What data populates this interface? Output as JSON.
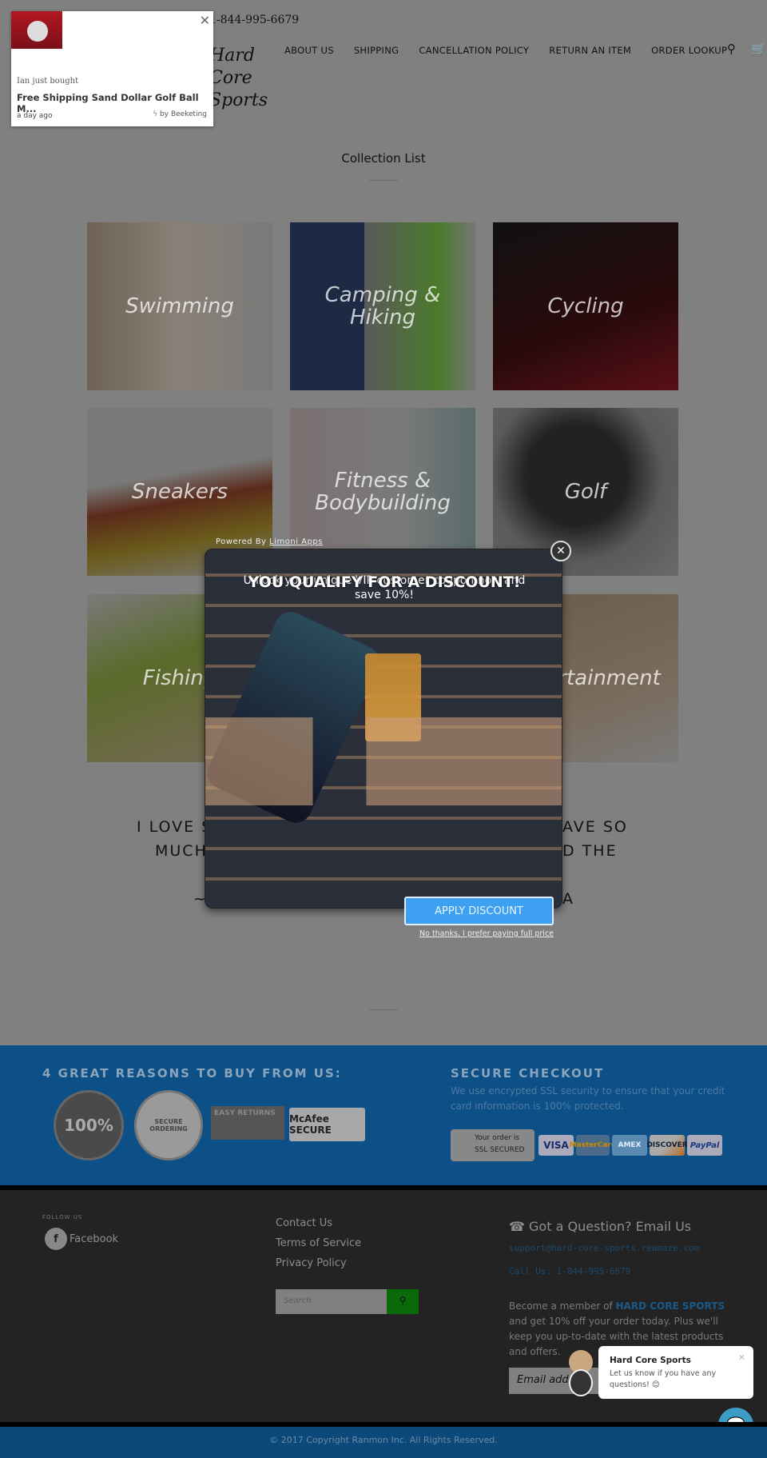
{
  "header": {
    "phone": "1-844-995-6679",
    "logo": "Hard Core Sports",
    "nav": [
      "ABOUT US",
      "SHIPPING",
      "CANCELLATION POLICY",
      "RETURN AN ITEM",
      "ORDER LOOKUP"
    ],
    "search_icon": "search-icon",
    "cart_icon": "cart-icon"
  },
  "collection": {
    "title": "Collection List",
    "items": [
      "Swimming",
      "Camping & Hiking",
      "Cycling",
      "Sneakers",
      "Fitness & Bodybuilding",
      "Golf",
      "Fishing",
      "Entertainment"
    ]
  },
  "testimonial": {
    "l1a": "I LOVE S",
    "l1b": "AVE SO",
    "l2a": "MUCH",
    "l2b": "D THE",
    "l3a": "~",
    "l3b": "A"
  },
  "notification": {
    "who": "Ian just bought",
    "product": "Free Shipping Sand Dollar Golf Ball M...",
    "time": "a day ago",
    "by": "by Beeketing"
  },
  "popup": {
    "powered": "Powered By",
    "powered_link": "Limoni Apps",
    "headline": "YOU QUALIFY FOR A DISCOUNT!",
    "subtext": "Unlock your unique VIP customer coupon now and save 10%!",
    "apply": "APPLY DISCOUNT",
    "decline": "No thanks, I prefer paying full price"
  },
  "trust": {
    "title": "4 GREAT REASONS TO BUY FROM US:",
    "badges": [
      "100%",
      "SECURE ORDERING",
      "EASY RETURNS",
      "McAfee SECURE"
    ],
    "secure_title": "SECURE CHECKOUT",
    "secure_text": "We use encrypted SSL security to ensure that your credit card information is 100% protected.",
    "ssl": "Your order is SSL SECURED",
    "cards": [
      "VISA",
      "MasterCard",
      "AMEX",
      "DISCOVER",
      "PayPal"
    ]
  },
  "footer": {
    "follow": "FOLLOW US",
    "facebook": "Facebook",
    "links": [
      "Contact Us",
      "Terms of Service",
      "Privacy Policy"
    ],
    "search_placeholder": "Search",
    "question": "Got a Question? Email Us",
    "email": "support@hard-core-sports.reamaze.com",
    "call": "Call Us: 1-844-995-6679",
    "member_pre": "Become a member of",
    "member_brand": "HARD CORE SPORTS",
    "member_post": "and get 10% off your order today. Plus we'll keep you up-to-date with the latest products and offers.",
    "email_placeholder": "Email address",
    "copyright": "© 2017 Copyright Ranmon Inc. All Rights Reserved."
  },
  "chat": {
    "name": "Hard Core Sports",
    "message": "Let us know if you have any questions! 😊"
  },
  "colors": {
    "accent": "#3ea0f0",
    "trust_bg": "#0d4f87",
    "footer_bg": "#232323"
  }
}
